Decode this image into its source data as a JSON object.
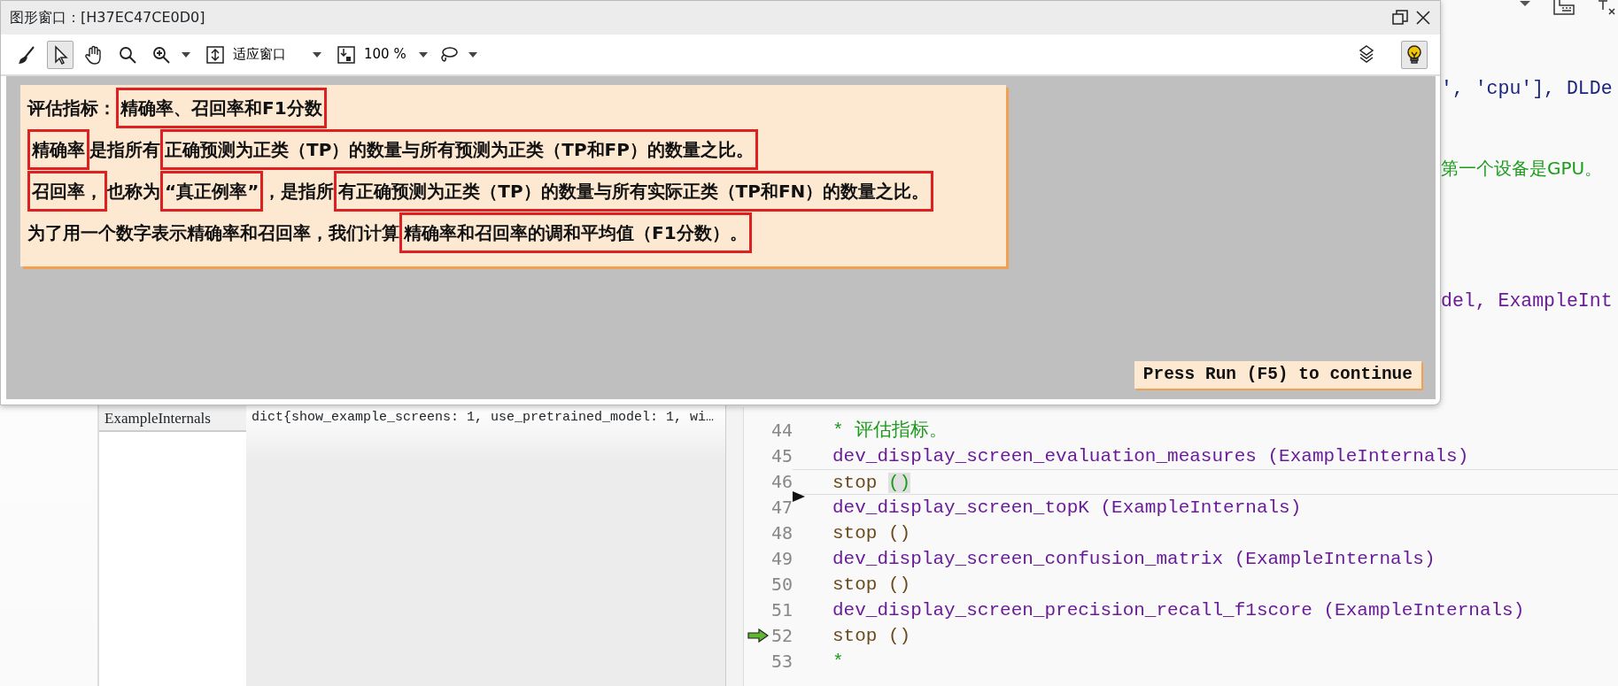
{
  "graphics_window": {
    "title": "图形窗口：[H37EC47CE0D0]",
    "toolbar": [
      {
        "kind": "broom",
        "selected": false
      },
      {
        "kind": "pointer",
        "selected": true
      },
      {
        "kind": "hand",
        "selected": false
      },
      {
        "kind": "magnifier",
        "selected": false
      },
      {
        "kind": "zoom-in",
        "selected": false
      },
      {
        "kind": "fit-select",
        "value": "适应窗口"
      },
      {
        "kind": "scale-select",
        "value": "100 %"
      },
      {
        "kind": "lasso",
        "selected": false
      }
    ],
    "right_tools": [
      {
        "kind": "layers",
        "selected": false
      },
      {
        "kind": "lightbulb",
        "selected": true
      }
    ],
    "message": [
      {
        "segments": [
          {
            "text": "评估指标：",
            "highlighted": false
          },
          {
            "text": "精确率、召回率和F1分数",
            "highlighted": true
          }
        ]
      },
      {
        "segments": [
          {
            "text": "精确率",
            "highlighted": true
          },
          {
            "text": "是指所有",
            "highlighted": false
          },
          {
            "text": "正确预测为正类（TP）的数量与所有预测为正类（TP和FP）的数量之比。",
            "highlighted": true
          }
        ]
      },
      {
        "segments": [
          {
            "text": "召回率，",
            "highlighted": true
          },
          {
            "text": "也称为",
            "highlighted": false
          },
          {
            "text": "“真正例率”",
            "highlighted": true
          },
          {
            "text": "，是指所",
            "highlighted": false
          },
          {
            "text": "有正确预测为正类（TP）的数量与所有实际正类（TP和FN）的数量之比。",
            "highlighted": true
          }
        ]
      },
      {
        "segments": [
          {
            "text": "为了用一个数字表示精确率和召回率，我们计算",
            "highlighted": false
          },
          {
            "text": "精确率和召回率的调和平均值（F1分数）。",
            "highlighted": true
          }
        ]
      }
    ],
    "continue_button": "Press Run (F5) to continue"
  },
  "editor_tail_lines": [
    {
      "text": "', 'cpu'], DLDe",
      "kind": "code"
    },
    {
      "text": "第一个设备是GPU。",
      "kind": "comment"
    },
    {
      "text": "del, ExampleInt",
      "kind": "proc"
    }
  ],
  "variables": [
    {
      "name": "ExampleInternals",
      "value": "dict{show_example_screens: 1, use_pretrained_model: 1, wi…"
    }
  ],
  "code_lines": [
    {
      "number": "44",
      "current": false,
      "pc": false,
      "tokens": [
        {
          "text": "* 评估指标。",
          "kind": "comment"
        }
      ]
    },
    {
      "number": "45",
      "current": false,
      "pc": false,
      "tokens": [
        {
          "text": "dev_display_screen_evaluation_measures (ExampleInternals)",
          "kind": "proc"
        }
      ]
    },
    {
      "number": "46",
      "current": true,
      "pc": false,
      "tokens": [
        {
          "text": "stop ",
          "kind": "keyword"
        },
        {
          "text": "()",
          "kind": "brace-match"
        }
      ]
    },
    {
      "number": "47",
      "current": false,
      "pc": false,
      "tokens": [
        {
          "text": "dev_display_screen_topK (ExampleInternals)",
          "kind": "proc"
        }
      ]
    },
    {
      "number": "48",
      "current": false,
      "pc": false,
      "tokens": [
        {
          "text": "stop ()",
          "kind": "keyword"
        }
      ]
    },
    {
      "number": "49",
      "current": false,
      "pc": false,
      "tokens": [
        {
          "text": "dev_display_screen_confusion_matrix (ExampleInternals)",
          "kind": "proc"
        }
      ]
    },
    {
      "number": "50",
      "current": false,
      "pc": false,
      "tokens": [
        {
          "text": "stop ()",
          "kind": "keyword"
        }
      ]
    },
    {
      "number": "51",
      "current": false,
      "pc": false,
      "tokens": [
        {
          "text": "dev_display_screen_precision_recall_f1score (ExampleInternals)",
          "kind": "proc"
        }
      ]
    },
    {
      "number": "52",
      "current": false,
      "pc": true,
      "tokens": [
        {
          "text": "stop ()",
          "kind": "keyword"
        }
      ]
    },
    {
      "number": "53",
      "current": false,
      "pc": false,
      "tokens": [
        {
          "text": "*",
          "kind": "comment"
        }
      ]
    }
  ]
}
